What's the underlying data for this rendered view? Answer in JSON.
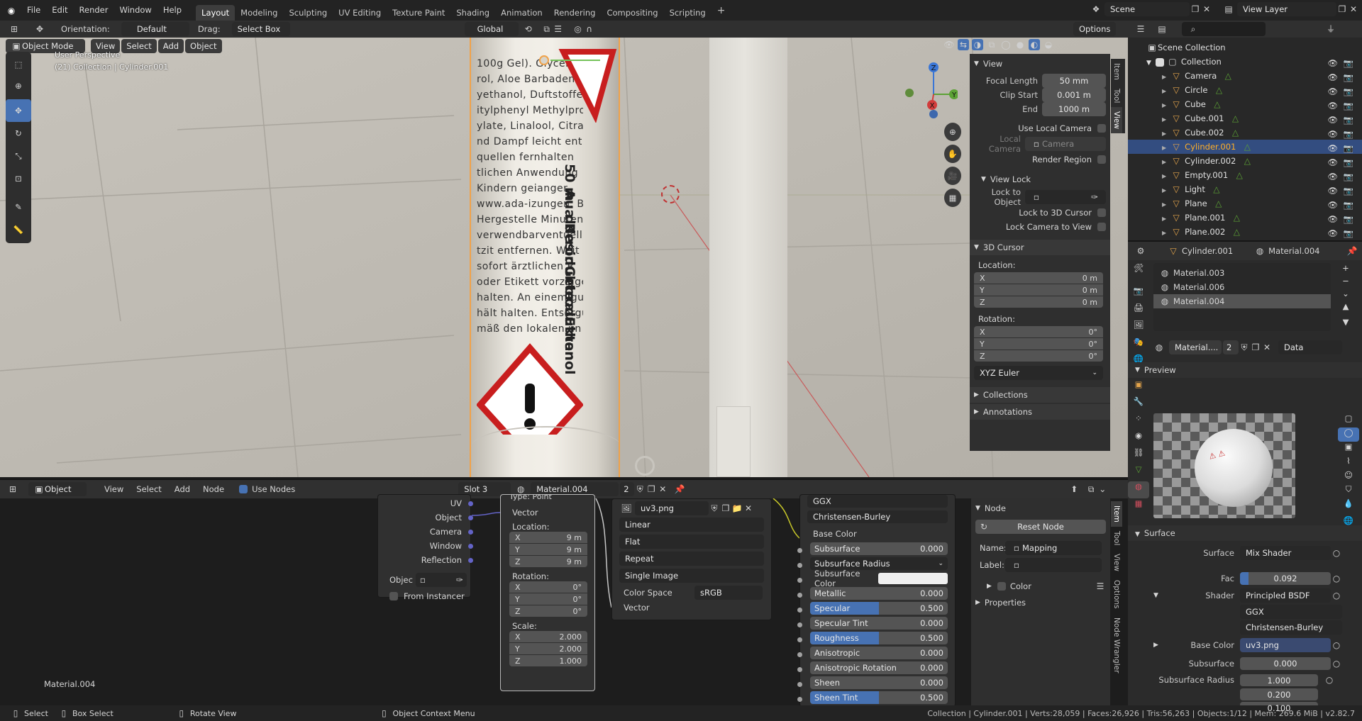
{
  "topbar": {
    "menus": [
      "File",
      "Edit",
      "Render",
      "Window",
      "Help"
    ],
    "workspaces": [
      "Layout",
      "Modeling",
      "Sculpting",
      "UV Editing",
      "Texture Paint",
      "Shading",
      "Animation",
      "Rendering",
      "Compositing",
      "Scripting"
    ],
    "add_tab": "+",
    "scene": "Scene",
    "view_layer": "View Layer"
  },
  "toolbar": {
    "orientation_label": "Orientation:",
    "orientation_value": "Default",
    "drag_label": "Drag:",
    "drag_value": "Select Box",
    "transform": "Global",
    "options": "Options"
  },
  "viewport": {
    "mode": "Object Mode",
    "menus": [
      "View",
      "Select",
      "Add",
      "Object"
    ],
    "perspective": "User Perspective",
    "collection_info": "(21) Collection | Cylinder.001",
    "bottle_text": [
      "100g Gel). Glycer",
      "rol, Aloe Barbadens",
      "yethanol, Duftstoffe",
      "itylphenyl Methylpro",
      "ylate, Linalool, Citra",
      "nd Dampf leicht ent",
      "quellen fernhalten",
      "tlichen Anwendung",
      "Kindern geianger",
      "www.ada-izungen. BEI KON",
      "Hergestelle Minuten lang be",
      "verwendbarventuell vorhanden",
      "tzit entfernen. Weit",
      "sofort ärztlichen R",
      "oder Etikett vorzeige",
      "halten. An einem gu",
      "hält halten. Entsorgu",
      "mäß den lokalen un"
    ],
    "bottle_side_text": [
      "50 m",
      "Aua Re",
      "ddesir",
      "rodukte",
      "Gebrau",
      "rodukten",
      "Ethanol"
    ],
    "gizmo": {
      "x": "X",
      "y": "Y",
      "z": "Z"
    }
  },
  "npanel": {
    "tabs": [
      "Item",
      "Tool",
      "View"
    ],
    "view": {
      "title": "View",
      "focal_length_label": "Focal Length",
      "focal_length": "50 mm",
      "clip_start_label": "Clip Start",
      "clip_start": "0.001 m",
      "end_label": "End",
      "end": "1000 m",
      "use_local_camera": "Use Local Camera",
      "local_camera_label": "Local Camera",
      "local_camera": "Camera",
      "render_region": "Render Region"
    },
    "view_lock": {
      "title": "View Lock",
      "lock_to_object": "Lock to Object",
      "lock_3d_cursor": "Lock to 3D Cursor",
      "lock_camera": "Lock Camera to View"
    },
    "cursor": {
      "title": "3D Cursor",
      "location": "Location:",
      "loc": [
        {
          "axis": "X",
          "value": "0 m"
        },
        {
          "axis": "Y",
          "value": "0 m"
        },
        {
          "axis": "Z",
          "value": "0 m"
        }
      ],
      "rotation": "Rotation:",
      "rot": [
        {
          "axis": "X",
          "value": "0°"
        },
        {
          "axis": "Y",
          "value": "0°"
        },
        {
          "axis": "Z",
          "value": "0°"
        }
      ],
      "rot_mode": "XYZ Euler"
    },
    "collections": "Collections",
    "annotations": "Annotations"
  },
  "outliner": {
    "root": "Scene Collection",
    "collection": "Collection",
    "items": [
      {
        "name": "Camera",
        "color": "#e3a44b",
        "selected": false
      },
      {
        "name": "Circle",
        "color": "#e3a44b",
        "selected": false
      },
      {
        "name": "Cube",
        "color": "#e3a44b",
        "selected": false
      },
      {
        "name": "Cube.001",
        "color": "#e3a44b",
        "selected": false
      },
      {
        "name": "Cube.002",
        "color": "#e3a44b",
        "selected": false
      },
      {
        "name": "Cylinder.001",
        "color": "#e3a44b",
        "selected": true
      },
      {
        "name": "Cylinder.002",
        "color": "#e3a44b",
        "selected": false
      },
      {
        "name": "Empty.001",
        "color": "#e3a44b",
        "selected": false
      },
      {
        "name": "Light",
        "color": "#e3a44b",
        "selected": false
      },
      {
        "name": "Plane",
        "color": "#e3a44b",
        "selected": false
      },
      {
        "name": "Plane.001",
        "color": "#e3a44b",
        "selected": false
      },
      {
        "name": "Plane.002",
        "color": "#e3a44b",
        "selected": false
      }
    ]
  },
  "properties": {
    "object": "Cylinder.001",
    "material": "Material.004",
    "slots": [
      "Material.003",
      "Material.006",
      "Material.004"
    ],
    "mat_field": "Material....",
    "mat_users": "2",
    "link": "Data",
    "preview": "Preview",
    "surface_section": "Surface",
    "surface_label": "Surface",
    "surface": "Mix Shader",
    "fac_label": "Fac",
    "fac": "0.092",
    "fac_fraction": 0.092,
    "shader_label": "Shader",
    "shader": "Principled BSDF",
    "ggx": "GGX",
    "cb": "Christensen-Burley",
    "base_color_label": "Base Color",
    "base_color": "uv3.png",
    "subsurface_label": "Subsurface",
    "subsurface": "0.000",
    "ssr_label": "Subsurface Radius",
    "ssr": [
      "1.000",
      "0.200",
      "0.100"
    ]
  },
  "node_editor": {
    "editor": "Object",
    "menus": [
      "View",
      "Select",
      "Add",
      "Node"
    ],
    "use_nodes": "Use Nodes",
    "slot": "Slot 3",
    "material": "Material.004",
    "users": "2",
    "footer": "Material.004",
    "texcoord": {
      "outputs": [
        "UV",
        "Object",
        "Camera",
        "Window",
        "Reflection"
      ],
      "object_label": "Objec",
      "from_instancer": "From Instancer"
    },
    "mapping": {
      "type_label": "Type:",
      "type": "Point",
      "vector": "Vector",
      "location": "Location:",
      "loc": [
        {
          "axis": "X",
          "value": "9 m"
        },
        {
          "axis": "Y",
          "value": "9 m"
        },
        {
          "axis": "Z",
          "value": "9 m"
        }
      ],
      "rotation": "Rotation:",
      "rot": [
        {
          "axis": "X",
          "value": "0°"
        },
        {
          "axis": "Y",
          "value": "0°"
        },
        {
          "axis": "Z",
          "value": "0°"
        }
      ],
      "scale": "Scale:",
      "scl": [
        {
          "axis": "X",
          "value": "2.000"
        },
        {
          "axis": "Y",
          "value": "2.000"
        },
        {
          "axis": "Z",
          "value": "1.000"
        }
      ]
    },
    "image": {
      "file": "uv3.png",
      "interp": "Linear",
      "proj": "Flat",
      "ext": "Repeat",
      "source": "Single Image",
      "cs_label": "Color Space",
      "cs": "sRGB",
      "vector": "Vector"
    },
    "bsdf": {
      "dist": "GGX",
      "sss": "Christensen-Burley",
      "base_color": "Base Color",
      "rows": [
        {
          "label": "Subsurface",
          "value": "0.000",
          "fill": 0
        },
        {
          "label": "Subsurface Radius",
          "value": "",
          "fill": -1
        },
        {
          "label": "Subsurface Color",
          "value": "",
          "fill": -2
        },
        {
          "label": "Metallic",
          "value": "0.000",
          "fill": 0
        },
        {
          "label": "Specular",
          "value": "0.500",
          "fill": 0.5
        },
        {
          "label": "Specular Tint",
          "value": "0.000",
          "fill": 0
        },
        {
          "label": "Roughness",
          "value": "0.500",
          "fill": 0.5
        },
        {
          "label": "Anisotropic",
          "value": "0.000",
          "fill": 0
        },
        {
          "label": "Anisotropic Rotation",
          "value": "0.000",
          "fill": 0
        },
        {
          "label": "Sheen",
          "value": "0.000",
          "fill": 0
        },
        {
          "label": "Sheen Tint",
          "value": "0.500",
          "fill": 0.5
        }
      ]
    },
    "side": {
      "tabs": [
        "Item",
        "Tool",
        "View",
        "Options",
        "Node Wrangler"
      ],
      "node_title": "Node",
      "reset": "Reset Node",
      "name_label": "Name:",
      "name": "Mapping",
      "label_label": "Label:",
      "color": "Color",
      "properties": "Properties"
    }
  },
  "statusbar": {
    "select": "Select",
    "box_select": "Box Select",
    "rotate": "Rotate View",
    "context": "Object Context Menu",
    "stats": "Collection | Cylinder.001 | Verts:28,059 | Faces:26,926 | Tris:56,263 | Objects:1/12 | Mem: 269.6 MiB | v2.82.7"
  }
}
